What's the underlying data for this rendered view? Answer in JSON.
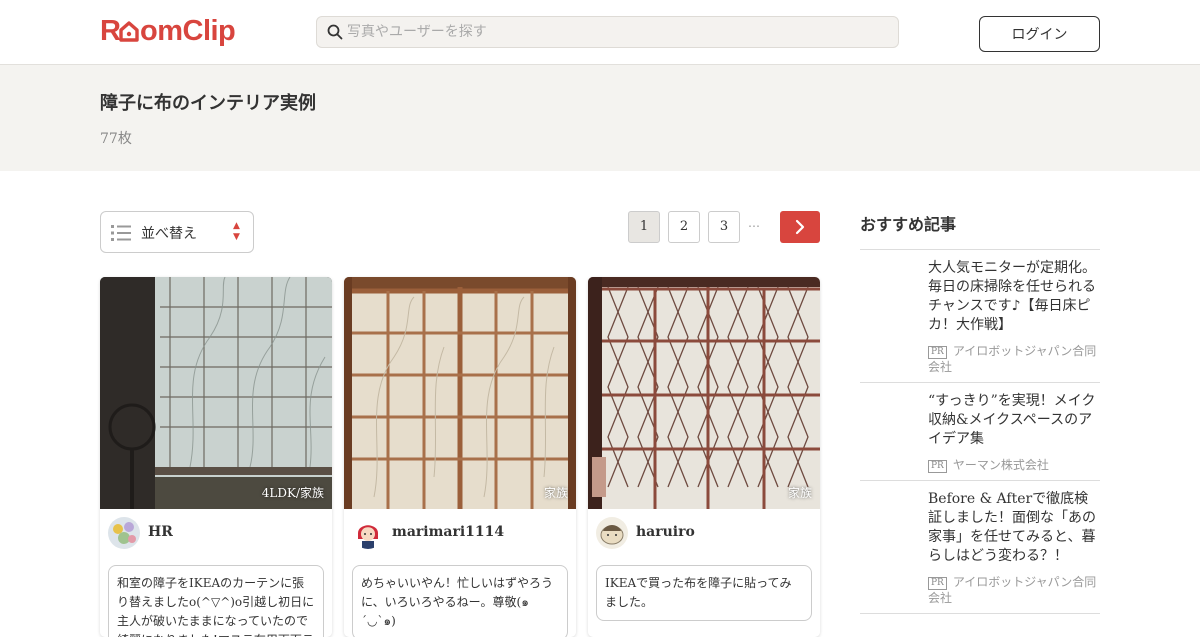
{
  "header": {
    "logo_text": "RoomClip",
    "search_placeholder": "写真やユーザーを探す",
    "login_label": "ログイン",
    "accent_color": "#d8453e"
  },
  "title_band": {
    "title": "障子に布のインテリア実例",
    "count": "77枚"
  },
  "controls": {
    "sort_label": "並べ替え",
    "pages": [
      "1",
      "2",
      "3"
    ],
    "active_page": "1",
    "ellipsis": "…"
  },
  "cards": [
    {
      "tag": "4LDK/家族",
      "username": "HR",
      "caption": "和室の障子をIKEAのカーテンに張り替えましたo(^▽^)o引越し初日に主人が破いたままになっていたので綺麗になりました!マステ布用両面テ"
    },
    {
      "tag": "家族",
      "username": "marimari1114",
      "caption": "めちゃいいやん！忙しいはずやろうに、いろいろやるねー。尊敬(๑´◡`๑)"
    },
    {
      "tag": "家族",
      "username": "haruiro",
      "caption": "IKEAで買った布を障子に貼ってみました。"
    }
  ],
  "sidebar": {
    "title": "おすすめ記事",
    "articles": [
      {
        "title": "大人気モニターが定期化。毎日の床掃除を任せられるチャンスです♪【毎日床ピカ！大作戦】",
        "pr_label": "PR",
        "sponsor": "アイロボットジャパン合同会社"
      },
      {
        "title": "“すっきり”を実現！メイク収納&メイクスペースのアイデア集",
        "pr_label": "PR",
        "sponsor": "ヤーマン株式会社"
      },
      {
        "title": "Before & Afterで徹底検証しました！面倒な「あの家事」を任せてみると、暮らしはどう変わる？！",
        "pr_label": "PR",
        "sponsor": "アイロボットジャパン合同会社"
      }
    ]
  }
}
